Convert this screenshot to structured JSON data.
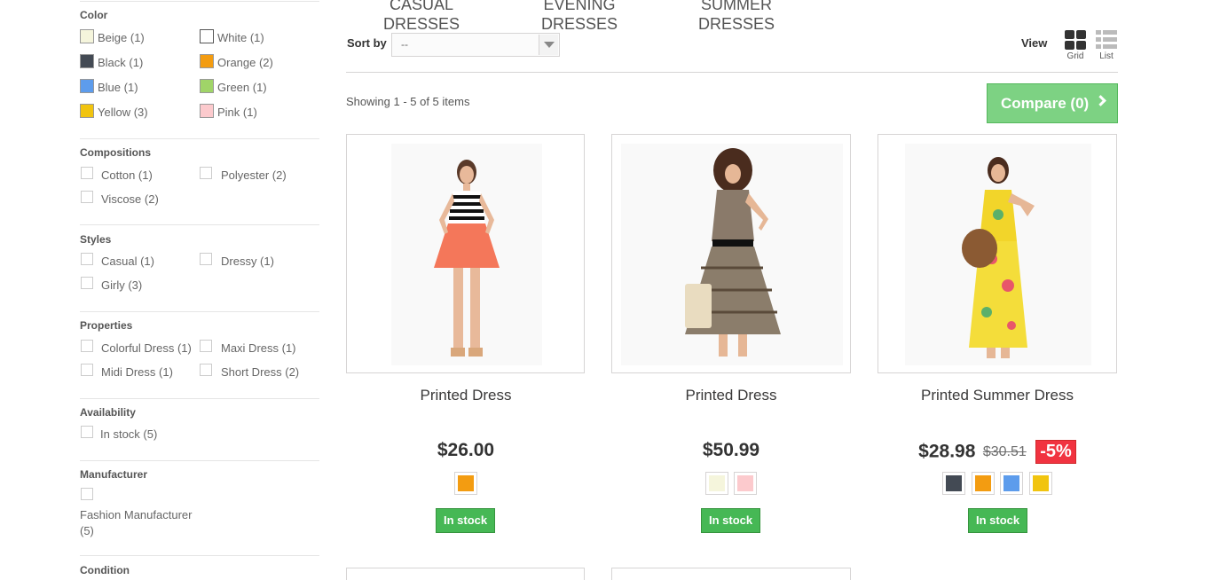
{
  "categories": [
    "CASUAL DRESSES",
    "EVENING DRESSES",
    "SUMMER DRESSES"
  ],
  "filters": {
    "color": {
      "title": "Color",
      "options": [
        {
          "label": "Beige (1)",
          "color": "#f5f5dc"
        },
        {
          "label": "White (1)",
          "color": "#ffffff"
        },
        {
          "label": "Black (1)",
          "color": "#434a54"
        },
        {
          "label": "Orange (2)",
          "color": "#f39c11"
        },
        {
          "label": "Blue (1)",
          "color": "#5d9cec"
        },
        {
          "label": "Green (1)",
          "color": "#a0d468"
        },
        {
          "label": "Yellow (3)",
          "color": "#f1c40f"
        },
        {
          "label": "Pink (1)",
          "color": "#fccacd"
        }
      ]
    },
    "compositions": {
      "title": "Compositions",
      "options": [
        "Cotton (1)",
        "Polyester (2)",
        "Viscose (2)"
      ]
    },
    "styles": {
      "title": "Styles",
      "options": [
        "Casual (1)",
        "Dressy (1)",
        "Girly (3)"
      ]
    },
    "properties": {
      "title": "Properties",
      "options": [
        "Colorful Dress (1)",
        "Maxi Dress (1)",
        "Midi Dress (1)",
        "Short Dress (2)"
      ]
    },
    "availability": {
      "title": "Availability",
      "options": [
        "In stock (5)"
      ]
    },
    "manufacturer": {
      "title": "Manufacturer",
      "options": [
        "Fashion Manufacturer (5)"
      ],
      "option_line1": "Fashion Manufacturer",
      "option_line2": "(5)"
    },
    "condition": {
      "title": "Condition"
    }
  },
  "toolbar": {
    "sort_label": "Sort by",
    "sort_value": "--",
    "view_label": "View",
    "grid_label": "Grid",
    "list_label": "List"
  },
  "results": {
    "showing": "Showing 1 - 5 of 5 items",
    "compare_label": "Compare (0)"
  },
  "products": [
    {
      "name": "Printed Dress",
      "price": "$26.00",
      "colors": [
        "#f39c11"
      ],
      "stock": "In stock"
    },
    {
      "name": "Printed Dress",
      "price": "$50.99",
      "colors": [
        "#f5f5dc",
        "#fccacd"
      ],
      "stock": "In stock"
    },
    {
      "name": "Printed Summer Dress",
      "price": "$28.98",
      "old_price": "$30.51",
      "discount": "-5%",
      "colors": [
        "#434a54",
        "#f39c11",
        "#5d9cec",
        "#f1c40f"
      ],
      "stock": "In stock"
    }
  ]
}
